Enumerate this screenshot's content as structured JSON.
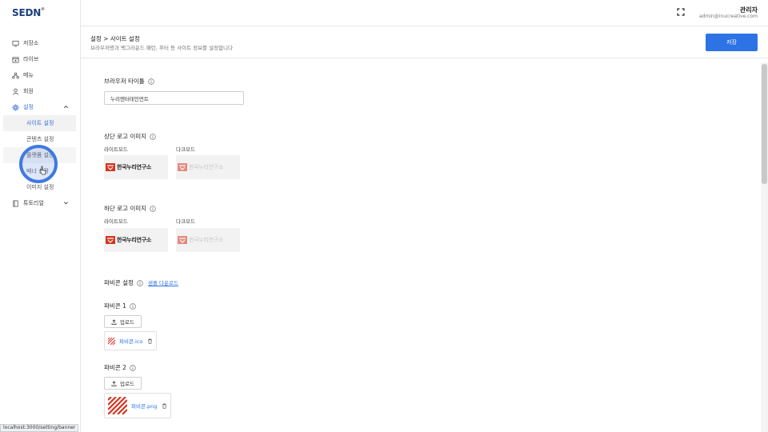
{
  "brand": {
    "logo_text": "SEDN",
    "trademark": "®"
  },
  "sidebar": {
    "items": [
      {
        "label": "저장소"
      },
      {
        "label": "라이브"
      },
      {
        "label": "메뉴"
      },
      {
        "label": "회원"
      },
      {
        "label": "설정"
      },
      {
        "label": "튜토리얼"
      }
    ],
    "settings_sub": [
      {
        "label": "사이트 설정"
      },
      {
        "label": "콘텐츠 설정"
      },
      {
        "label": "플랫폼 설정"
      },
      {
        "label": "배너 설정"
      },
      {
        "label": "이미지 설정"
      }
    ]
  },
  "status_bar": {
    "url": "localhost:3000/setting/banner"
  },
  "header": {
    "user_name": "관리자",
    "user_email": "admin@inucreative.com"
  },
  "page": {
    "breadcrumb": "설정 > 사이트 설정",
    "description": "브라우저명과 백그라운드 패턴, 푸터 등 사이트 정보를 설정합니다",
    "save_label": "저장"
  },
  "form": {
    "browser_title": {
      "label": "브라우저 타이틀",
      "value": "누리엔터테인먼트"
    },
    "top_logo": {
      "label": "상단 로고 이미지",
      "light_label": "라이트모드",
      "dark_label": "다크모드",
      "logo_text": "한국누리연구소"
    },
    "bottom_logo": {
      "label": "하단 로고 이미지",
      "light_label": "라이트모드",
      "dark_label": "다크모드",
      "logo_text": "한국누리연구소"
    },
    "favicon": {
      "label": "파비콘 설정",
      "sample_link": "샘플 다운로드",
      "items": [
        {
          "label": "파비콘 1",
          "upload_label": "업로드",
          "file_name": "파비콘.ico"
        },
        {
          "label": "파비콘 2",
          "upload_label": "업로드",
          "file_name": "파비콘.png"
        }
      ]
    }
  },
  "colors": {
    "accent": "#2d73e6",
    "brand": "#1c3f7a",
    "logo_mark": "#d6341f"
  }
}
